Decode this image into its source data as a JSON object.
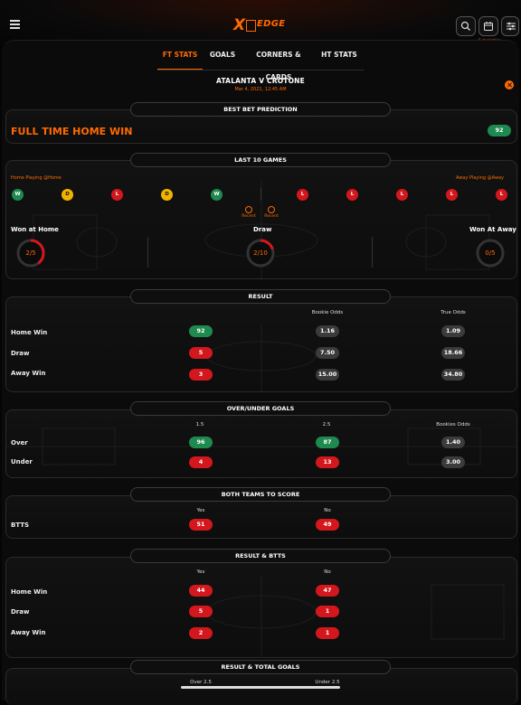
{
  "app": {
    "logo_x": "X",
    "logo_text": "EDGE",
    "subscription": "Subscription"
  },
  "tabs": [
    {
      "label": "FT STATS",
      "active": true
    },
    {
      "label": "GOALS",
      "active": false
    },
    {
      "label": "CORNERS & CARDS",
      "active": false
    },
    {
      "label": "HT STATS",
      "active": false
    }
  ],
  "match": {
    "title": "ATALANTA V CROTONE",
    "date": "Mar 4, 2021, 12:45 AM"
  },
  "best_bet": {
    "header": "BEST BET PREDICTION",
    "label": "FULL TIME HOME WIN",
    "value": "92"
  },
  "last10": {
    "header": "LAST 10 GAMES",
    "home_label": "Home Playing @Home",
    "away_label": "Away Playing @Away",
    "home_results": [
      "W",
      "D",
      "L",
      "D",
      "W"
    ],
    "away_results": [
      "L",
      "L",
      "L",
      "L",
      "L"
    ],
    "recent_label": "Recent",
    "won_home_label": "Won at Home",
    "won_home_value": "2/5",
    "won_home_fraction": 0.4,
    "draw_label": "Draw",
    "draw_value": "2/10",
    "draw_fraction": 0.2,
    "won_away_label": "Won At Away",
    "won_away_value": "0/5",
    "won_away_fraction": 0.0
  },
  "result": {
    "header": "RESULT",
    "col_bookie": "Bookie Odds",
    "col_true": "True Odds",
    "rows": [
      {
        "label": "Home Win",
        "pct": "92",
        "bookie": "1.16",
        "true": "1.09"
      },
      {
        "label": "Draw",
        "pct": "5",
        "bookie": "7.50",
        "true": "18.66"
      },
      {
        "label": "Away Win",
        "pct": "3",
        "bookie": "15.00",
        "true": "34.80"
      }
    ]
  },
  "ou": {
    "header": "OVER/UNDER GOALS",
    "col1": "1.5",
    "col2": "2.5",
    "col3": "Bookies Odds",
    "rows": [
      {
        "label": "Over",
        "a": "96",
        "b": "87",
        "c": "1.40"
      },
      {
        "label": "Under",
        "a": "4",
        "b": "13",
        "c": "3.00"
      }
    ]
  },
  "btts": {
    "header": "BOTH TEAMS TO SCORE",
    "col_yes": "Yes",
    "col_no": "No",
    "label": "BTTS",
    "yes": "51",
    "no": "49"
  },
  "rbtts": {
    "header": "RESULT & BTTS",
    "col_yes": "Yes",
    "col_no": "No",
    "rows": [
      {
        "label": "Home Win",
        "yes": "44",
        "no": "47"
      },
      {
        "label": "Draw",
        "yes": "5",
        "no": "1"
      },
      {
        "label": "Away Win",
        "yes": "2",
        "no": "1"
      }
    ]
  },
  "rtg": {
    "header": "RESULT & TOTAL GOALS",
    "col_over": "Over 2.5",
    "col_under": "Under 2.5"
  },
  "colors": {
    "accent": "#ff6a00",
    "green": "#1f8a4f",
    "red": "#d4171d",
    "yellow": "#f0b400"
  }
}
